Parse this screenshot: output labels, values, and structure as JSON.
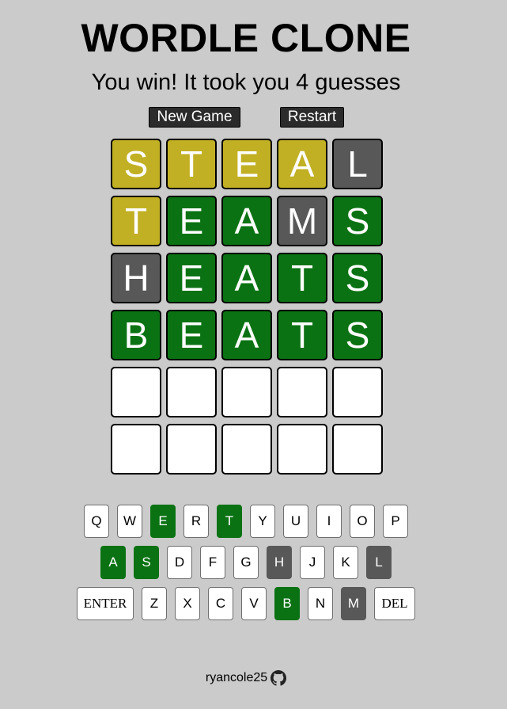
{
  "header": {
    "title": "WORDLE CLONE",
    "status": "You win! It took you 4 guesses"
  },
  "controls": {
    "new_game_label": "New Game",
    "restart_label": "Restart"
  },
  "board": {
    "rows": [
      [
        {
          "letter": "S",
          "state": "present"
        },
        {
          "letter": "T",
          "state": "present"
        },
        {
          "letter": "E",
          "state": "present"
        },
        {
          "letter": "A",
          "state": "present"
        },
        {
          "letter": "L",
          "state": "absent"
        }
      ],
      [
        {
          "letter": "T",
          "state": "present"
        },
        {
          "letter": "E",
          "state": "correct"
        },
        {
          "letter": "A",
          "state": "correct"
        },
        {
          "letter": "M",
          "state": "absent"
        },
        {
          "letter": "S",
          "state": "correct"
        }
      ],
      [
        {
          "letter": "H",
          "state": "absent"
        },
        {
          "letter": "E",
          "state": "correct"
        },
        {
          "letter": "A",
          "state": "correct"
        },
        {
          "letter": "T",
          "state": "correct"
        },
        {
          "letter": "S",
          "state": "correct"
        }
      ],
      [
        {
          "letter": "B",
          "state": "correct"
        },
        {
          "letter": "E",
          "state": "correct"
        },
        {
          "letter": "A",
          "state": "correct"
        },
        {
          "letter": "T",
          "state": "correct"
        },
        {
          "letter": "S",
          "state": "correct"
        }
      ],
      [
        {
          "letter": "",
          "state": "empty"
        },
        {
          "letter": "",
          "state": "empty"
        },
        {
          "letter": "",
          "state": "empty"
        },
        {
          "letter": "",
          "state": "empty"
        },
        {
          "letter": "",
          "state": "empty"
        }
      ],
      [
        {
          "letter": "",
          "state": "empty"
        },
        {
          "letter": "",
          "state": "empty"
        },
        {
          "letter": "",
          "state": "empty"
        },
        {
          "letter": "",
          "state": "empty"
        },
        {
          "letter": "",
          "state": "empty"
        }
      ]
    ]
  },
  "keyboard": {
    "rows": [
      [
        {
          "label": "Q",
          "state": "unused"
        },
        {
          "label": "W",
          "state": "unused"
        },
        {
          "label": "E",
          "state": "correct"
        },
        {
          "label": "R",
          "state": "unused"
        },
        {
          "label": "T",
          "state": "correct"
        },
        {
          "label": "Y",
          "state": "unused"
        },
        {
          "label": "U",
          "state": "unused"
        },
        {
          "label": "I",
          "state": "unused"
        },
        {
          "label": "O",
          "state": "unused"
        },
        {
          "label": "P",
          "state": "unused"
        }
      ],
      [
        {
          "label": "A",
          "state": "correct"
        },
        {
          "label": "S",
          "state": "correct"
        },
        {
          "label": "D",
          "state": "unused"
        },
        {
          "label": "F",
          "state": "unused"
        },
        {
          "label": "G",
          "state": "unused"
        },
        {
          "label": "H",
          "state": "absent"
        },
        {
          "label": "J",
          "state": "unused"
        },
        {
          "label": "K",
          "state": "unused"
        },
        {
          "label": "L",
          "state": "absent"
        }
      ],
      [
        {
          "label": "ENTER",
          "state": "unused",
          "wide": true
        },
        {
          "label": "Z",
          "state": "unused"
        },
        {
          "label": "X",
          "state": "unused"
        },
        {
          "label": "C",
          "state": "unused"
        },
        {
          "label": "V",
          "state": "unused"
        },
        {
          "label": "B",
          "state": "correct"
        },
        {
          "label": "N",
          "state": "unused"
        },
        {
          "label": "M",
          "state": "absent"
        },
        {
          "label": "DEL",
          "state": "unused",
          "wide": true
        }
      ]
    ]
  },
  "footer": {
    "username": "ryancole25",
    "icon": "github-icon"
  },
  "colors": {
    "background": "#cbcbcb",
    "correct": "#0a7213",
    "present": "#c1b024",
    "absent": "#585858",
    "button_dark": "#2b2b2b"
  }
}
